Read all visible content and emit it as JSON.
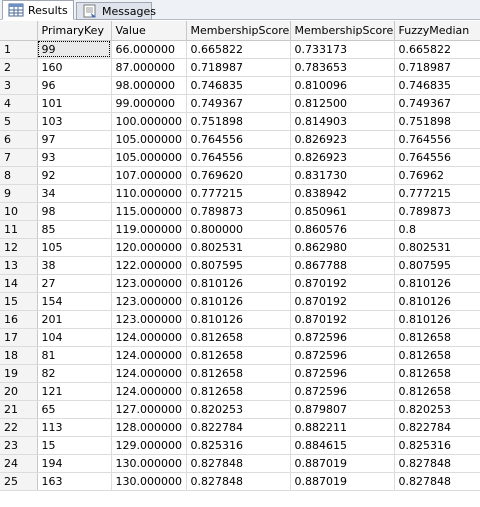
{
  "tabs": [
    {
      "label": "Results",
      "icon": "grid-icon"
    },
    {
      "label": "Messages",
      "icon": "messages-icon"
    }
  ],
  "columns": [
    "",
    "PrimaryKey",
    "Value",
    "MembershipScore",
    "MembershipScore",
    "FuzzyMedian"
  ],
  "rows": [
    [
      "1",
      "99",
      "66.000000",
      "0.665822",
      "0.733173",
      "0.665822"
    ],
    [
      "2",
      "160",
      "87.000000",
      "0.718987",
      "0.783653",
      "0.718987"
    ],
    [
      "3",
      "96",
      "98.000000",
      "0.746835",
      "0.810096",
      "0.746835"
    ],
    [
      "4",
      "101",
      "99.000000",
      "0.749367",
      "0.812500",
      "0.749367"
    ],
    [
      "5",
      "103",
      "100.000000",
      "0.751898",
      "0.814903",
      "0.751898"
    ],
    [
      "6",
      "97",
      "105.000000",
      "0.764556",
      "0.826923",
      "0.764556"
    ],
    [
      "7",
      "93",
      "105.000000",
      "0.764556",
      "0.826923",
      "0.764556"
    ],
    [
      "8",
      "92",
      "107.000000",
      "0.769620",
      "0.831730",
      "0.76962"
    ],
    [
      "9",
      "34",
      "110.000000",
      "0.777215",
      "0.838942",
      "0.777215"
    ],
    [
      "10",
      "98",
      "115.000000",
      "0.789873",
      "0.850961",
      "0.789873"
    ],
    [
      "11",
      "85",
      "119.000000",
      "0.800000",
      "0.860576",
      "0.8"
    ],
    [
      "12",
      "105",
      "120.000000",
      "0.802531",
      "0.862980",
      "0.802531"
    ],
    [
      "13",
      "38",
      "122.000000",
      "0.807595",
      "0.867788",
      "0.807595"
    ],
    [
      "14",
      "27",
      "123.000000",
      "0.810126",
      "0.870192",
      "0.810126"
    ],
    [
      "15",
      "154",
      "123.000000",
      "0.810126",
      "0.870192",
      "0.810126"
    ],
    [
      "16",
      "201",
      "123.000000",
      "0.810126",
      "0.870192",
      "0.810126"
    ],
    [
      "17",
      "104",
      "124.000000",
      "0.812658",
      "0.872596",
      "0.812658"
    ],
    [
      "18",
      "81",
      "124.000000",
      "0.812658",
      "0.872596",
      "0.812658"
    ],
    [
      "19",
      "82",
      "124.000000",
      "0.812658",
      "0.872596",
      "0.812658"
    ],
    [
      "20",
      "121",
      "124.000000",
      "0.812658",
      "0.872596",
      "0.812658"
    ],
    [
      "21",
      "65",
      "127.000000",
      "0.820253",
      "0.879807",
      "0.820253"
    ],
    [
      "22",
      "113",
      "128.000000",
      "0.822784",
      "0.882211",
      "0.822784"
    ],
    [
      "23",
      "15",
      "129.000000",
      "0.825316",
      "0.884615",
      "0.825316"
    ],
    [
      "24",
      "194",
      "130.000000",
      "0.827848",
      "0.887019",
      "0.827848"
    ],
    [
      "25",
      "163",
      "130.000000",
      "0.827848",
      "0.887019",
      "0.827848"
    ]
  ]
}
